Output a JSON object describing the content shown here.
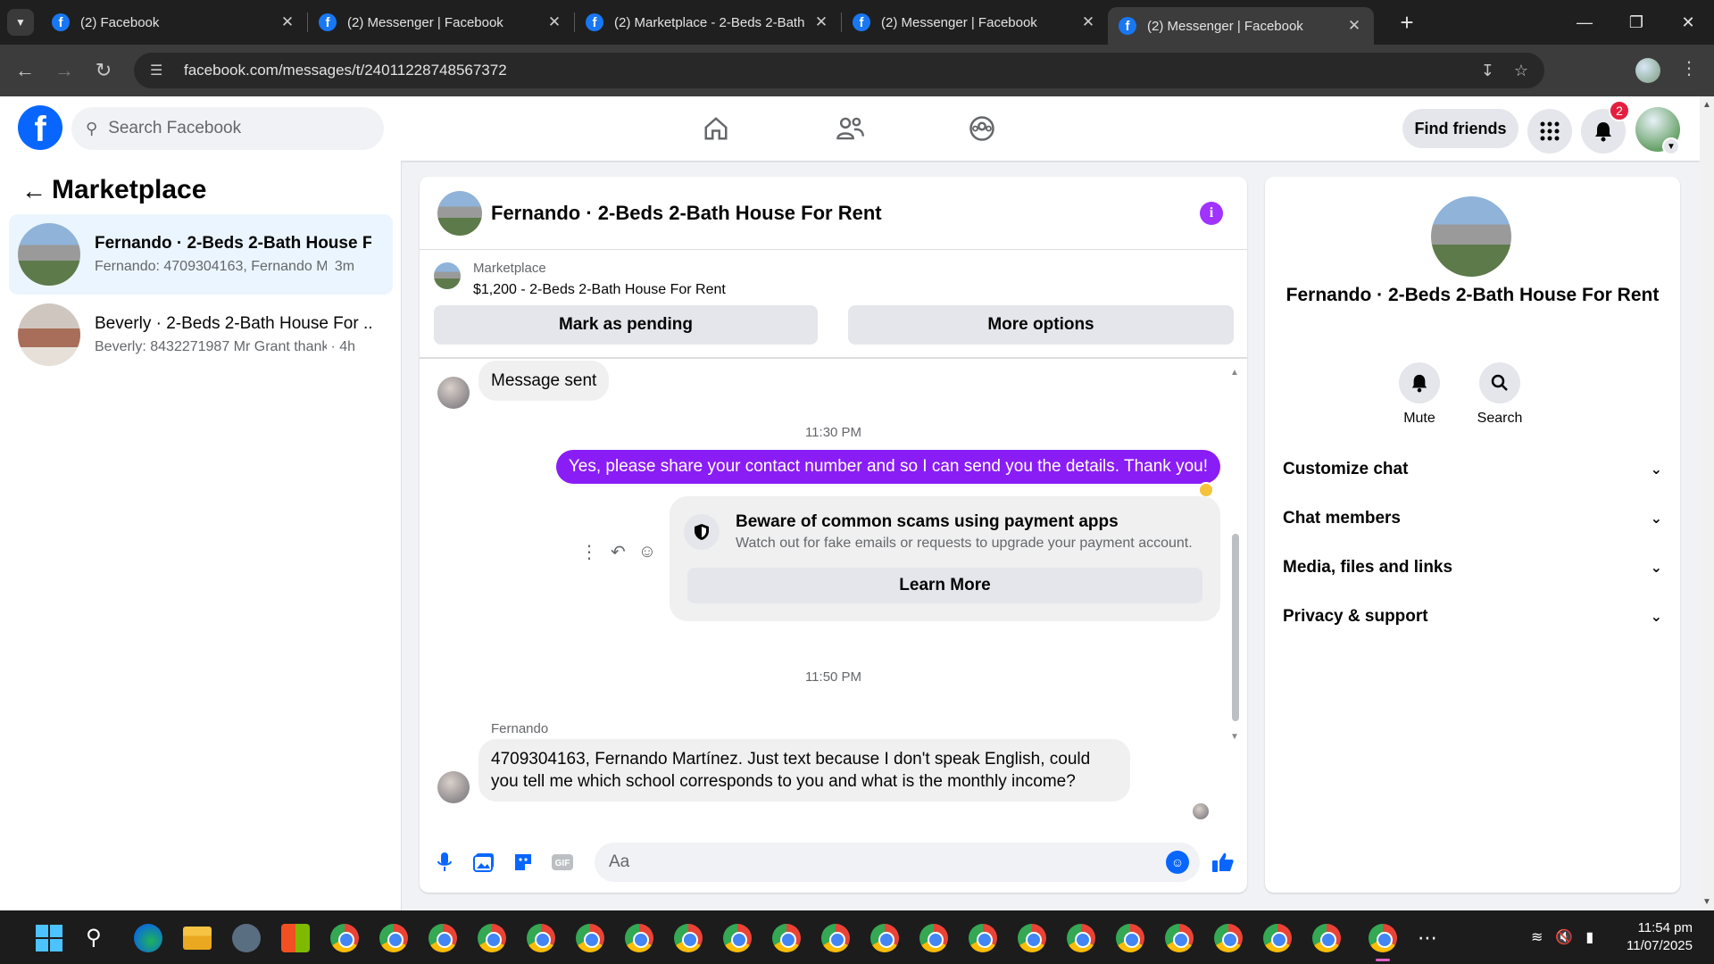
{
  "browser": {
    "tabs": [
      {
        "title": "(2) Facebook",
        "active": false
      },
      {
        "title": "(2) Messenger | Facebook",
        "active": false
      },
      {
        "title": "(2) Marketplace - 2-Beds 2-Bath",
        "active": false
      },
      {
        "title": "(2) Messenger | Facebook",
        "active": false
      },
      {
        "title": "(2) Messenger | Facebook",
        "active": true
      }
    ],
    "url": "facebook.com/messages/t/24011228748567372"
  },
  "header": {
    "search_placeholder": "Search Facebook",
    "find_friends_label": "Find friends",
    "notification_count": "2"
  },
  "sidebar": {
    "title": "Marketplace",
    "conversations": [
      {
        "name": "Fernando · 2-Beds 2-Bath House F...",
        "snippet": "Fernando: 4709304163, Fernando Ma...",
        "time": "3m",
        "active": true
      },
      {
        "name": "Beverly · 2-Beds 2-Bath House For ...",
        "snippet": "Beverly: 8432271987 Mr Grant thanks",
        "time": "4h",
        "active": false
      }
    ]
  },
  "chat": {
    "title": "Fernando · 2-Beds 2-Bath House For Rent",
    "listing": {
      "source": "Marketplace",
      "price_title": "$1,200 - 2-Beds 2-Bath House For Rent",
      "mark_pending_label": "Mark as pending",
      "more_options_label": "More options"
    },
    "messages": {
      "msg1": "Message sent",
      "ts1": "11:30 PM",
      "msg2": "Yes, please share your contact number and so I can send you the details. Thank you!",
      "scam_title": "Beware of common scams using payment apps",
      "scam_sub": "Watch out for fake emails or requests to upgrade your payment account.",
      "learn_more": "Learn More",
      "ts2": "11:50 PM",
      "sender": "Fernando",
      "msg3": "4709304163, Fernando Martínez. Just text because I don't speak English, could you tell me which school corresponds to you and what is the monthly income?"
    },
    "composer_placeholder": "Aa"
  },
  "info_panel": {
    "name": "Fernando · 2-Beds 2-Bath House For Rent",
    "mute_label": "Mute",
    "search_label": "Search",
    "sections": [
      "Customize chat",
      "Chat members",
      "Media, files and links",
      "Privacy & support"
    ]
  },
  "taskbar": {
    "time": "11:54 pm",
    "date": "11/07/2025"
  },
  "colors": {
    "fb_blue": "#0866ff",
    "message_purple": "#8a1cf5",
    "info_purple": "#a033ff",
    "badge_red": "#e41e3f"
  }
}
